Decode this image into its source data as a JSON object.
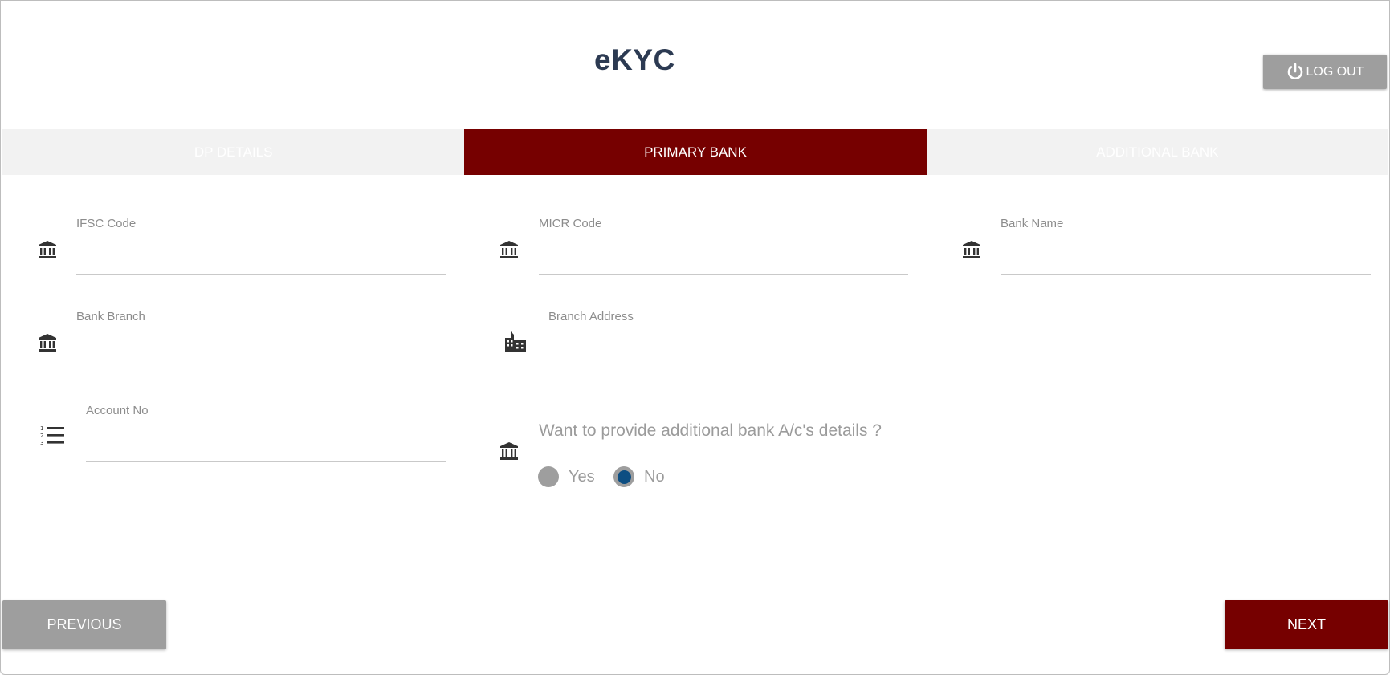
{
  "header": {
    "title": "eKYC",
    "logout_label": "LOG OUT"
  },
  "tabs": [
    {
      "label": "DP DETAILS",
      "active": false
    },
    {
      "label": "PRIMARY BANK",
      "active": true
    },
    {
      "label": "ADDITIONAL BANK",
      "active": false
    }
  ],
  "form": {
    "ifsc": {
      "label": "IFSC Code",
      "value": ""
    },
    "micr": {
      "label": "MICR Code",
      "value": ""
    },
    "bank_name": {
      "label": "Bank Name",
      "value": ""
    },
    "bank_branch": {
      "label": "Bank Branch",
      "value": ""
    },
    "branch_address": {
      "label": "Branch Address",
      "value": ""
    },
    "account_no": {
      "label": "Account No",
      "value": ""
    },
    "additional_question": "Want to provide additional bank A/c's details ?",
    "radio_yes": "Yes",
    "radio_no": "No",
    "selected": "No"
  },
  "footer": {
    "previous_label": "PREVIOUS",
    "next_label": "NEXT"
  },
  "colors": {
    "accent": "#760000",
    "tab_bar": "#f2f2f2",
    "button_gray": "#9e9e9e",
    "radio_selected": "#0d4e82",
    "title": "#2c3a52"
  }
}
